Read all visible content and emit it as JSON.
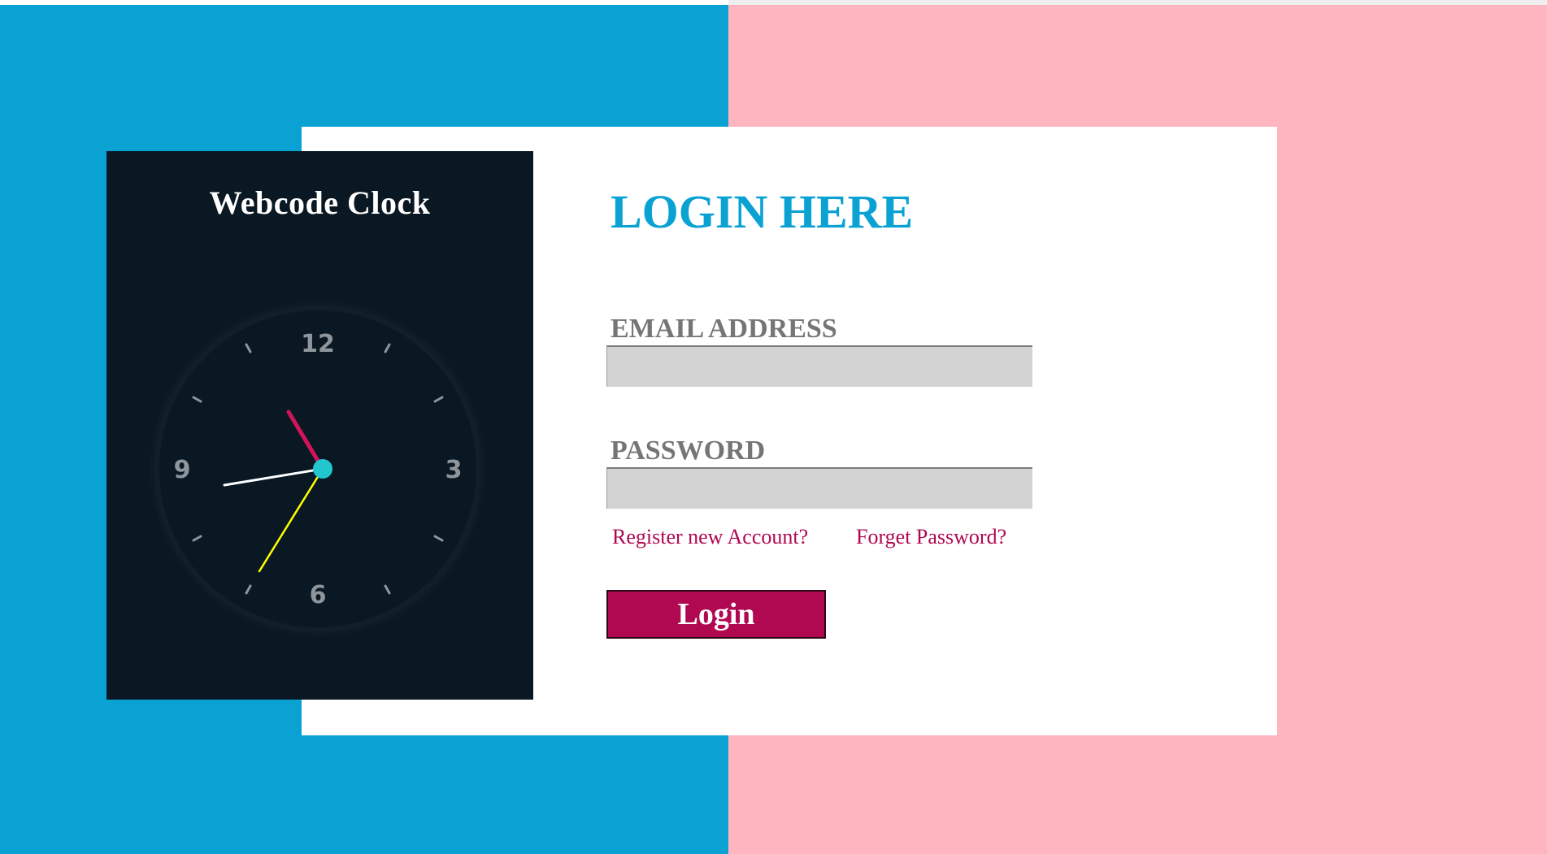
{
  "colors": {
    "left_background": "#09a2d3",
    "right_background": "#ffb5c0",
    "card_background": "#ffffff",
    "clock_panel": "#0a1823",
    "accent_blue": "#09a2d3",
    "accent_magenta": "#b00851",
    "label_gray": "#757575",
    "input_gray": "#d3d3d3"
  },
  "clock": {
    "title": "Webcode Clock",
    "numerals": [
      "12",
      "3",
      "6",
      "9"
    ],
    "hands": {
      "hour_color": "#d4145a",
      "minute_color": "#ffffff",
      "second_color": "#ffff00",
      "center_color": "#22c6cf"
    }
  },
  "login": {
    "heading": "LOGIN HERE",
    "email_label": "EMAIL ADDRESS",
    "email_value": "",
    "password_label": "PASSWORD",
    "password_value": "",
    "register_link": "Register new Account?",
    "forget_link": "Forget Password?",
    "submit_label": "Login"
  }
}
